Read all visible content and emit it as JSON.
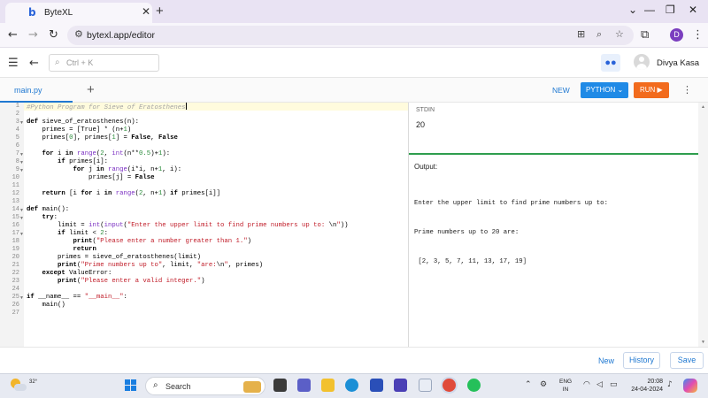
{
  "browser": {
    "tab_title": "ByteXL",
    "tab_favicon": "b",
    "tab_close": "✕",
    "new_tab": "+",
    "url": "bytexl.app/editor",
    "profile_initial": "D",
    "window_controls": [
      "⌄",
      "—",
      "❐",
      "✕"
    ]
  },
  "header": {
    "search_placeholder": "Ctrl + K",
    "user_name": "Divya Kasa"
  },
  "toolbar": {
    "file_tab": "main.py",
    "add_file": "+",
    "new_label": "NEW",
    "language_label": "PYTHON ⌄",
    "run_label": "RUN ▶"
  },
  "editor": {
    "line_numbers": [
      "1",
      "2",
      "3",
      "4",
      "5",
      "6",
      "7",
      "8",
      "9",
      "10",
      "11",
      "12",
      "13",
      "14",
      "15",
      "16",
      "17",
      "18",
      "19",
      "20",
      "21",
      "22",
      "23",
      "24",
      "25",
      "26",
      "27"
    ],
    "fold_lines": [
      3,
      7,
      8,
      9,
      14,
      15,
      17,
      25
    ],
    "lines": [
      [
        {
          "t": "#Python Program for Sieve of Eratosthenes",
          "c": "cm"
        }
      ],
      [],
      [
        {
          "t": "def ",
          "c": "kw"
        },
        {
          "t": "sieve_of_eratosthenes(n):"
        }
      ],
      [
        {
          "t": "    primes = [True] * (n+"
        },
        {
          "t": "1",
          "c": "num"
        },
        {
          "t": ")"
        }
      ],
      [
        {
          "t": "    primes["
        },
        {
          "t": "0",
          "c": "num"
        },
        {
          "t": "], primes["
        },
        {
          "t": "1",
          "c": "num"
        },
        {
          "t": "] = "
        },
        {
          "t": "False",
          "c": "kw"
        },
        {
          "t": ", "
        },
        {
          "t": "False",
          "c": "kw"
        }
      ],
      [],
      [
        {
          "t": "    "
        },
        {
          "t": "for ",
          "c": "kw"
        },
        {
          "t": "i "
        },
        {
          "t": "in ",
          "c": "kw"
        },
        {
          "t": "range",
          "c": "bi"
        },
        {
          "t": "("
        },
        {
          "t": "2",
          "c": "num"
        },
        {
          "t": ", "
        },
        {
          "t": "int",
          "c": "bi"
        },
        {
          "t": "(n**"
        },
        {
          "t": "0.5",
          "c": "num"
        },
        {
          "t": ")+"
        },
        {
          "t": "1",
          "c": "num"
        },
        {
          "t": "):"
        }
      ],
      [
        {
          "t": "        "
        },
        {
          "t": "if ",
          "c": "kw"
        },
        {
          "t": "primes[i]:"
        }
      ],
      [
        {
          "t": "            "
        },
        {
          "t": "for ",
          "c": "kw"
        },
        {
          "t": "j "
        },
        {
          "t": "in ",
          "c": "kw"
        },
        {
          "t": "range",
          "c": "bi"
        },
        {
          "t": "(i*i, n+"
        },
        {
          "t": "1",
          "c": "num"
        },
        {
          "t": ", i):"
        }
      ],
      [
        {
          "t": "                primes[j] = "
        },
        {
          "t": "False",
          "c": "kw"
        }
      ],
      [],
      [
        {
          "t": "    "
        },
        {
          "t": "return ",
          "c": "kw"
        },
        {
          "t": "[i "
        },
        {
          "t": "for ",
          "c": "kw"
        },
        {
          "t": "i "
        },
        {
          "t": "in ",
          "c": "kw"
        },
        {
          "t": "range",
          "c": "bi"
        },
        {
          "t": "("
        },
        {
          "t": "2",
          "c": "num"
        },
        {
          "t": ", n+"
        },
        {
          "t": "1",
          "c": "num"
        },
        {
          "t": ") "
        },
        {
          "t": "if ",
          "c": "kw"
        },
        {
          "t": "primes[i]]"
        }
      ],
      [],
      [
        {
          "t": "def ",
          "c": "kw"
        },
        {
          "t": "main():"
        }
      ],
      [
        {
          "t": "    "
        },
        {
          "t": "try",
          "c": "kw"
        },
        {
          "t": ":"
        }
      ],
      [
        {
          "t": "        limit = "
        },
        {
          "t": "int",
          "c": "bi"
        },
        {
          "t": "("
        },
        {
          "t": "input",
          "c": "bi"
        },
        {
          "t": "("
        },
        {
          "t": "\"Enter the upper limit to find prime numbers up to: ",
          "c": "str"
        },
        {
          "t": "\\n"
        },
        {
          "t": "\"",
          "c": "str"
        },
        {
          "t": "))"
        }
      ],
      [
        {
          "t": "        "
        },
        {
          "t": "if ",
          "c": "kw"
        },
        {
          "t": "limit < "
        },
        {
          "t": "2",
          "c": "num"
        },
        {
          "t": ":"
        }
      ],
      [
        {
          "t": "            "
        },
        {
          "t": "print",
          "c": "kw"
        },
        {
          "t": "("
        },
        {
          "t": "\"Please enter a number greater than 1.\"",
          "c": "str"
        },
        {
          "t": ")"
        }
      ],
      [
        {
          "t": "            "
        },
        {
          "t": "return",
          "c": "kw"
        }
      ],
      [
        {
          "t": "        primes = sieve_of_eratosthenes(limit)"
        }
      ],
      [
        {
          "t": "        "
        },
        {
          "t": "print",
          "c": "kw"
        },
        {
          "t": "("
        },
        {
          "t": "\"Prime numbers up to\"",
          "c": "str"
        },
        {
          "t": ", limit, "
        },
        {
          "t": "\"are:",
          "c": "str"
        },
        {
          "t": "\\n"
        },
        {
          "t": "\"",
          "c": "str"
        },
        {
          "t": ", primes)"
        }
      ],
      [
        {
          "t": "    "
        },
        {
          "t": "except ",
          "c": "kw"
        },
        {
          "t": "ValueError:"
        }
      ],
      [
        {
          "t": "        "
        },
        {
          "t": "print",
          "c": "kw"
        },
        {
          "t": "("
        },
        {
          "t": "\"Please enter a valid integer.\"",
          "c": "str"
        },
        {
          "t": ")"
        }
      ],
      [],
      [
        {
          "t": "if ",
          "c": "kw"
        },
        {
          "t": "__name__ == "
        },
        {
          "t": "\"__main__\"",
          "c": "str"
        },
        {
          "t": ":"
        }
      ],
      [
        {
          "t": "    main()"
        }
      ],
      []
    ]
  },
  "stdin": {
    "label": "STDIN",
    "value": "20"
  },
  "output": {
    "label": "Output:",
    "lines": [
      "Enter the upper limit to find prime numbers up to:",
      "Prime numbers up to 20 are:",
      " [2, 3, 5, 7, 11, 13, 17, 19]"
    ]
  },
  "footer": {
    "new_label": "New",
    "history_label": "History",
    "save_label": "Save"
  },
  "taskbar": {
    "temperature": "32°",
    "search_label": "Search",
    "language_line1": "ENG",
    "language_line2": "IN",
    "time": "20:08",
    "date": "24-04-2024"
  },
  "colors": {
    "accent_blue": "#1f8ae6",
    "run_orange": "#f26b1d",
    "stdin_divider_green": "#2e9e4e"
  }
}
